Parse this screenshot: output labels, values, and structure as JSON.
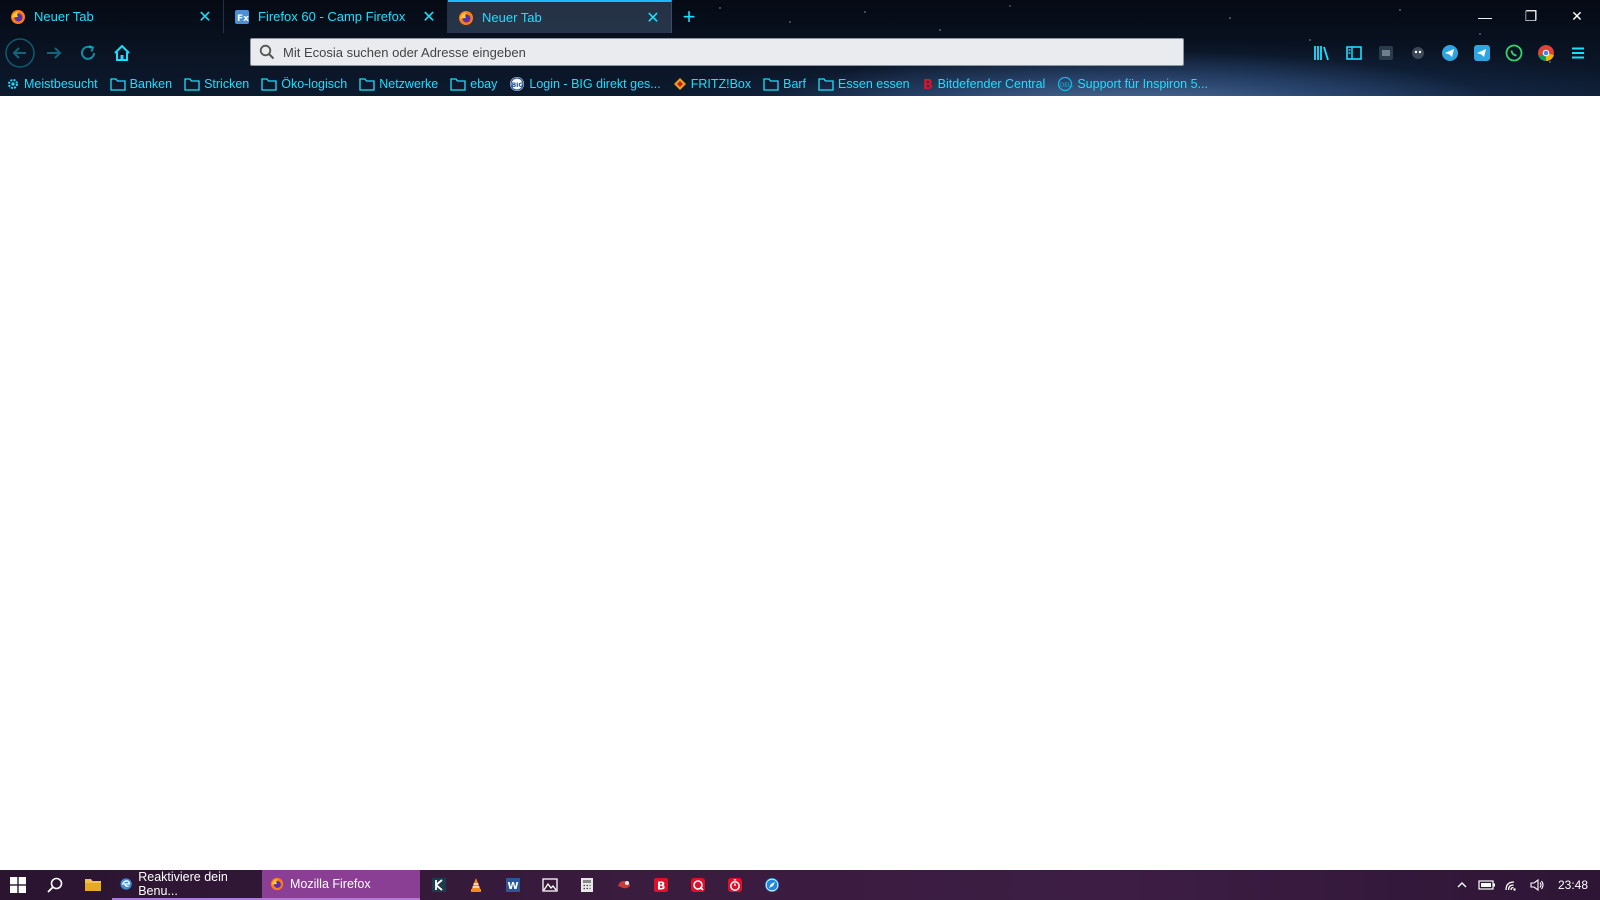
{
  "browser": {
    "tabs": [
      {
        "title": "Neuer Tab",
        "active": false,
        "favicon": "firefox-icon"
      },
      {
        "title": "Firefox 60 - Camp Firefox",
        "active": false,
        "favicon": "camp-firefox-icon"
      },
      {
        "title": "Neuer Tab",
        "active": true,
        "favicon": "firefox-icon"
      }
    ],
    "new_tab_label": "+",
    "window_controls": {
      "minimize": "—",
      "restore": "❐",
      "close": "✕"
    },
    "urlbar": {
      "placeholder": "Mit Ecosia suchen oder Adresse eingeben",
      "value": ""
    },
    "accent_color": "#19e0ff",
    "bookmarks": [
      {
        "label": "Meistbesucht",
        "icon": "gear-icon"
      },
      {
        "label": "Banken",
        "icon": "folder-icon"
      },
      {
        "label": "Stricken",
        "icon": "folder-icon"
      },
      {
        "label": "Öko-logisch",
        "icon": "folder-icon"
      },
      {
        "label": "Netzwerke",
        "icon": "folder-icon"
      },
      {
        "label": "ebay",
        "icon": "folder-icon"
      },
      {
        "label": "Login - BIG direkt ges...",
        "icon": "big-logo-icon"
      },
      {
        "label": "FRITZ!Box",
        "icon": "fritzbox-icon"
      },
      {
        "label": "Barf",
        "icon": "folder-icon"
      },
      {
        "label": "Essen essen",
        "icon": "folder-icon"
      },
      {
        "label": "Bitdefender Central",
        "icon": "bitdefender-icon"
      },
      {
        "label": "Support für Inspiron 5...",
        "icon": "dell-icon"
      }
    ]
  },
  "taskbar": {
    "running_apps": [
      {
        "label": "Reaktiviere dein Benu...",
        "icon": "edge-browser-icon",
        "active": false
      },
      {
        "label": "Mozilla Firefox",
        "icon": "firefox-icon",
        "active": true
      }
    ],
    "pinned": [
      "klick-icon",
      "vlc-icon",
      "word-icon",
      "photos-icon",
      "calculator-icon",
      "ram-icon",
      "bitdefender-icon",
      "antivirus-icon",
      "stopwatch-icon",
      "safari-icon"
    ],
    "clock": "23:48"
  }
}
